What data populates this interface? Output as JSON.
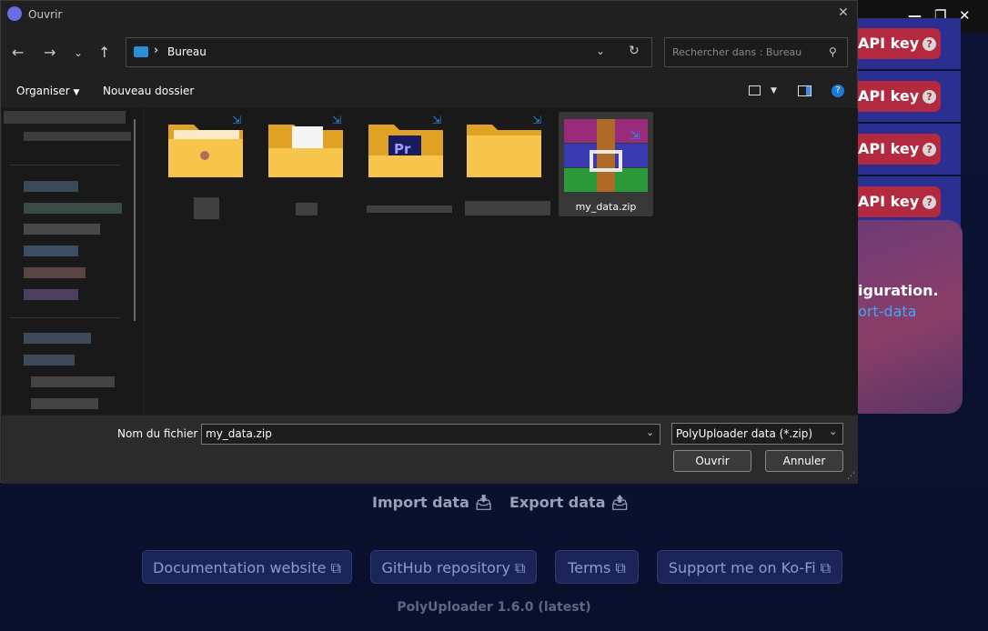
{
  "dialog": {
    "title": "Ouvrir",
    "address_crumb": "Bureau",
    "search_placeholder": "Rechercher dans : Bureau",
    "toolbar": {
      "organize_label": "Organiser",
      "new_folder_label": "Nouveau dossier"
    },
    "selected_file": "my_data.zip",
    "filename_label": "Nom du fichier :",
    "filename_value": "my_data.zip",
    "filter_value": "PolyUploader data (*.zip)",
    "open_label": "Ouvrir",
    "cancel_label": "Annuler"
  },
  "app": {
    "api_key_label": "API key",
    "config_text": "iguration.",
    "config_link": "ort-data",
    "import_label": "Import data",
    "export_label": "Export data",
    "links": [
      "Documentation website",
      "GitHub repository",
      "Terms",
      "Support me on Ko-Fi"
    ],
    "version": "PolyUploader 1.6.0 (latest)"
  },
  "colors": {
    "accent": "#b3293f",
    "link": "#3ea6ff",
    "dialog_bg": "#202020"
  },
  "icons": [
    "back-icon",
    "forward-icon",
    "up-icon",
    "refresh-icon",
    "search-icon",
    "help-icon",
    "external-link-icon",
    "winrar-icon"
  ]
}
